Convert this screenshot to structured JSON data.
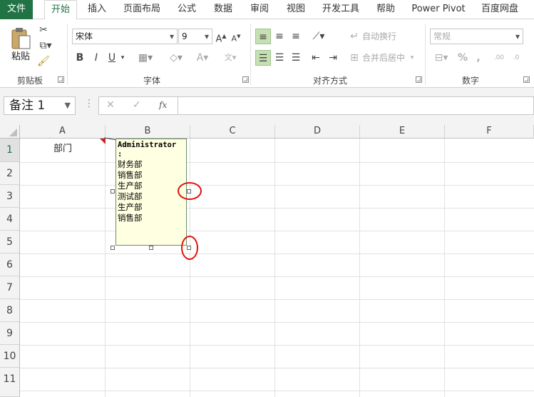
{
  "tabs": [
    "文件",
    "开始",
    "插入",
    "页面布局",
    "公式",
    "数据",
    "审阅",
    "视图",
    "开发工具",
    "帮助",
    "Power Pivot",
    "百度网盘"
  ],
  "active_tab": "开始",
  "ribbon": {
    "clipboard": {
      "paste_label": "粘贴",
      "group_label": "剪贴板"
    },
    "font": {
      "font_name": "宋体",
      "font_size": "9",
      "bold": "B",
      "italic": "I",
      "underline": "U",
      "group_label": "字体"
    },
    "alignment": {
      "wrap_text": "自动换行",
      "merge_center": "合并后居中",
      "group_label": "对齐方式"
    },
    "number": {
      "format": "常规",
      "percent": "%",
      "comma": ",",
      "group_label": "数字"
    }
  },
  "formula_bar": {
    "name_box": "备注 1",
    "cancel": "✕",
    "enter": "✓",
    "fx": "fx",
    "formula": ""
  },
  "columns": [
    "A",
    "B",
    "C",
    "D",
    "E",
    "F"
  ],
  "rows": [
    "1",
    "2",
    "3",
    "4",
    "5",
    "6",
    "7",
    "8",
    "9",
    "10",
    "11"
  ],
  "cells": {
    "A1": "部门"
  },
  "comment": {
    "author": "Administrator",
    "colon": ":",
    "lines": [
      "财务部",
      "销售部",
      "生产部",
      "测试部",
      "生产部",
      "销售部"
    ]
  },
  "colors": {
    "accent": "#217346",
    "comment_bg": "#ffffe1",
    "highlight_ring": "#e01010"
  }
}
